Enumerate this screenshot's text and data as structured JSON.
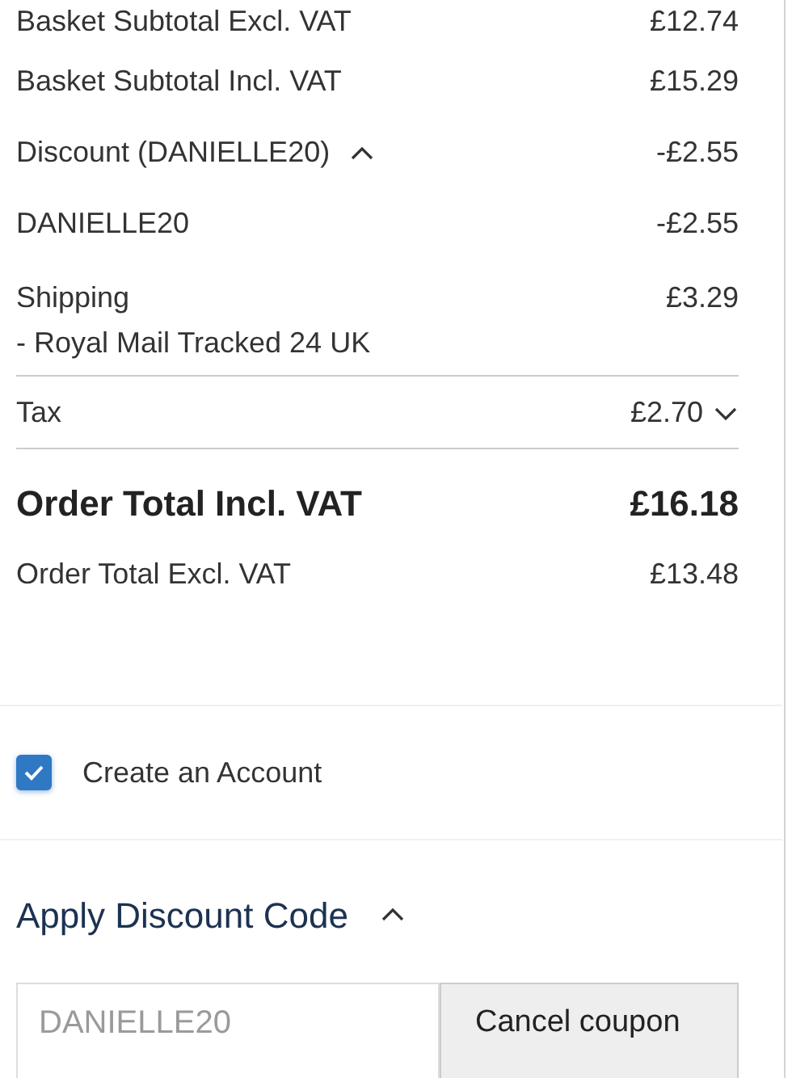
{
  "summary_rows": [
    {
      "kind": "line",
      "label": "Basket Subtotal Excl. VAT",
      "amount": "£12.74"
    },
    {
      "kind": "line",
      "label": "Basket Subtotal Incl. VAT",
      "amount": "£15.29"
    },
    {
      "kind": "toggle",
      "label": "Discount (DANIELLE20)",
      "amount": "-£2.55",
      "expanded": true
    },
    {
      "kind": "line",
      "label": "DANIELLE20",
      "amount": "-£2.55"
    },
    {
      "kind": "shipping",
      "label": "Shipping",
      "note": "- Royal Mail Tracked 24 UK",
      "amount": "£3.29"
    },
    {
      "kind": "tax",
      "label": "Tax",
      "amount": "£2.70",
      "expanded": false
    },
    {
      "kind": "total",
      "label": "Order Total Incl. VAT",
      "amount": "£16.18"
    },
    {
      "kind": "line",
      "label": "Order Total Excl. VAT",
      "amount": "£13.48"
    }
  ],
  "create_account": {
    "label": "Create an Account",
    "checked": true
  },
  "discount_section": {
    "title": "Apply Discount Code",
    "expanded": true,
    "code_field": {
      "value": "DANIELLE20",
      "disabled": true
    },
    "button": "Cancel coupon"
  }
}
